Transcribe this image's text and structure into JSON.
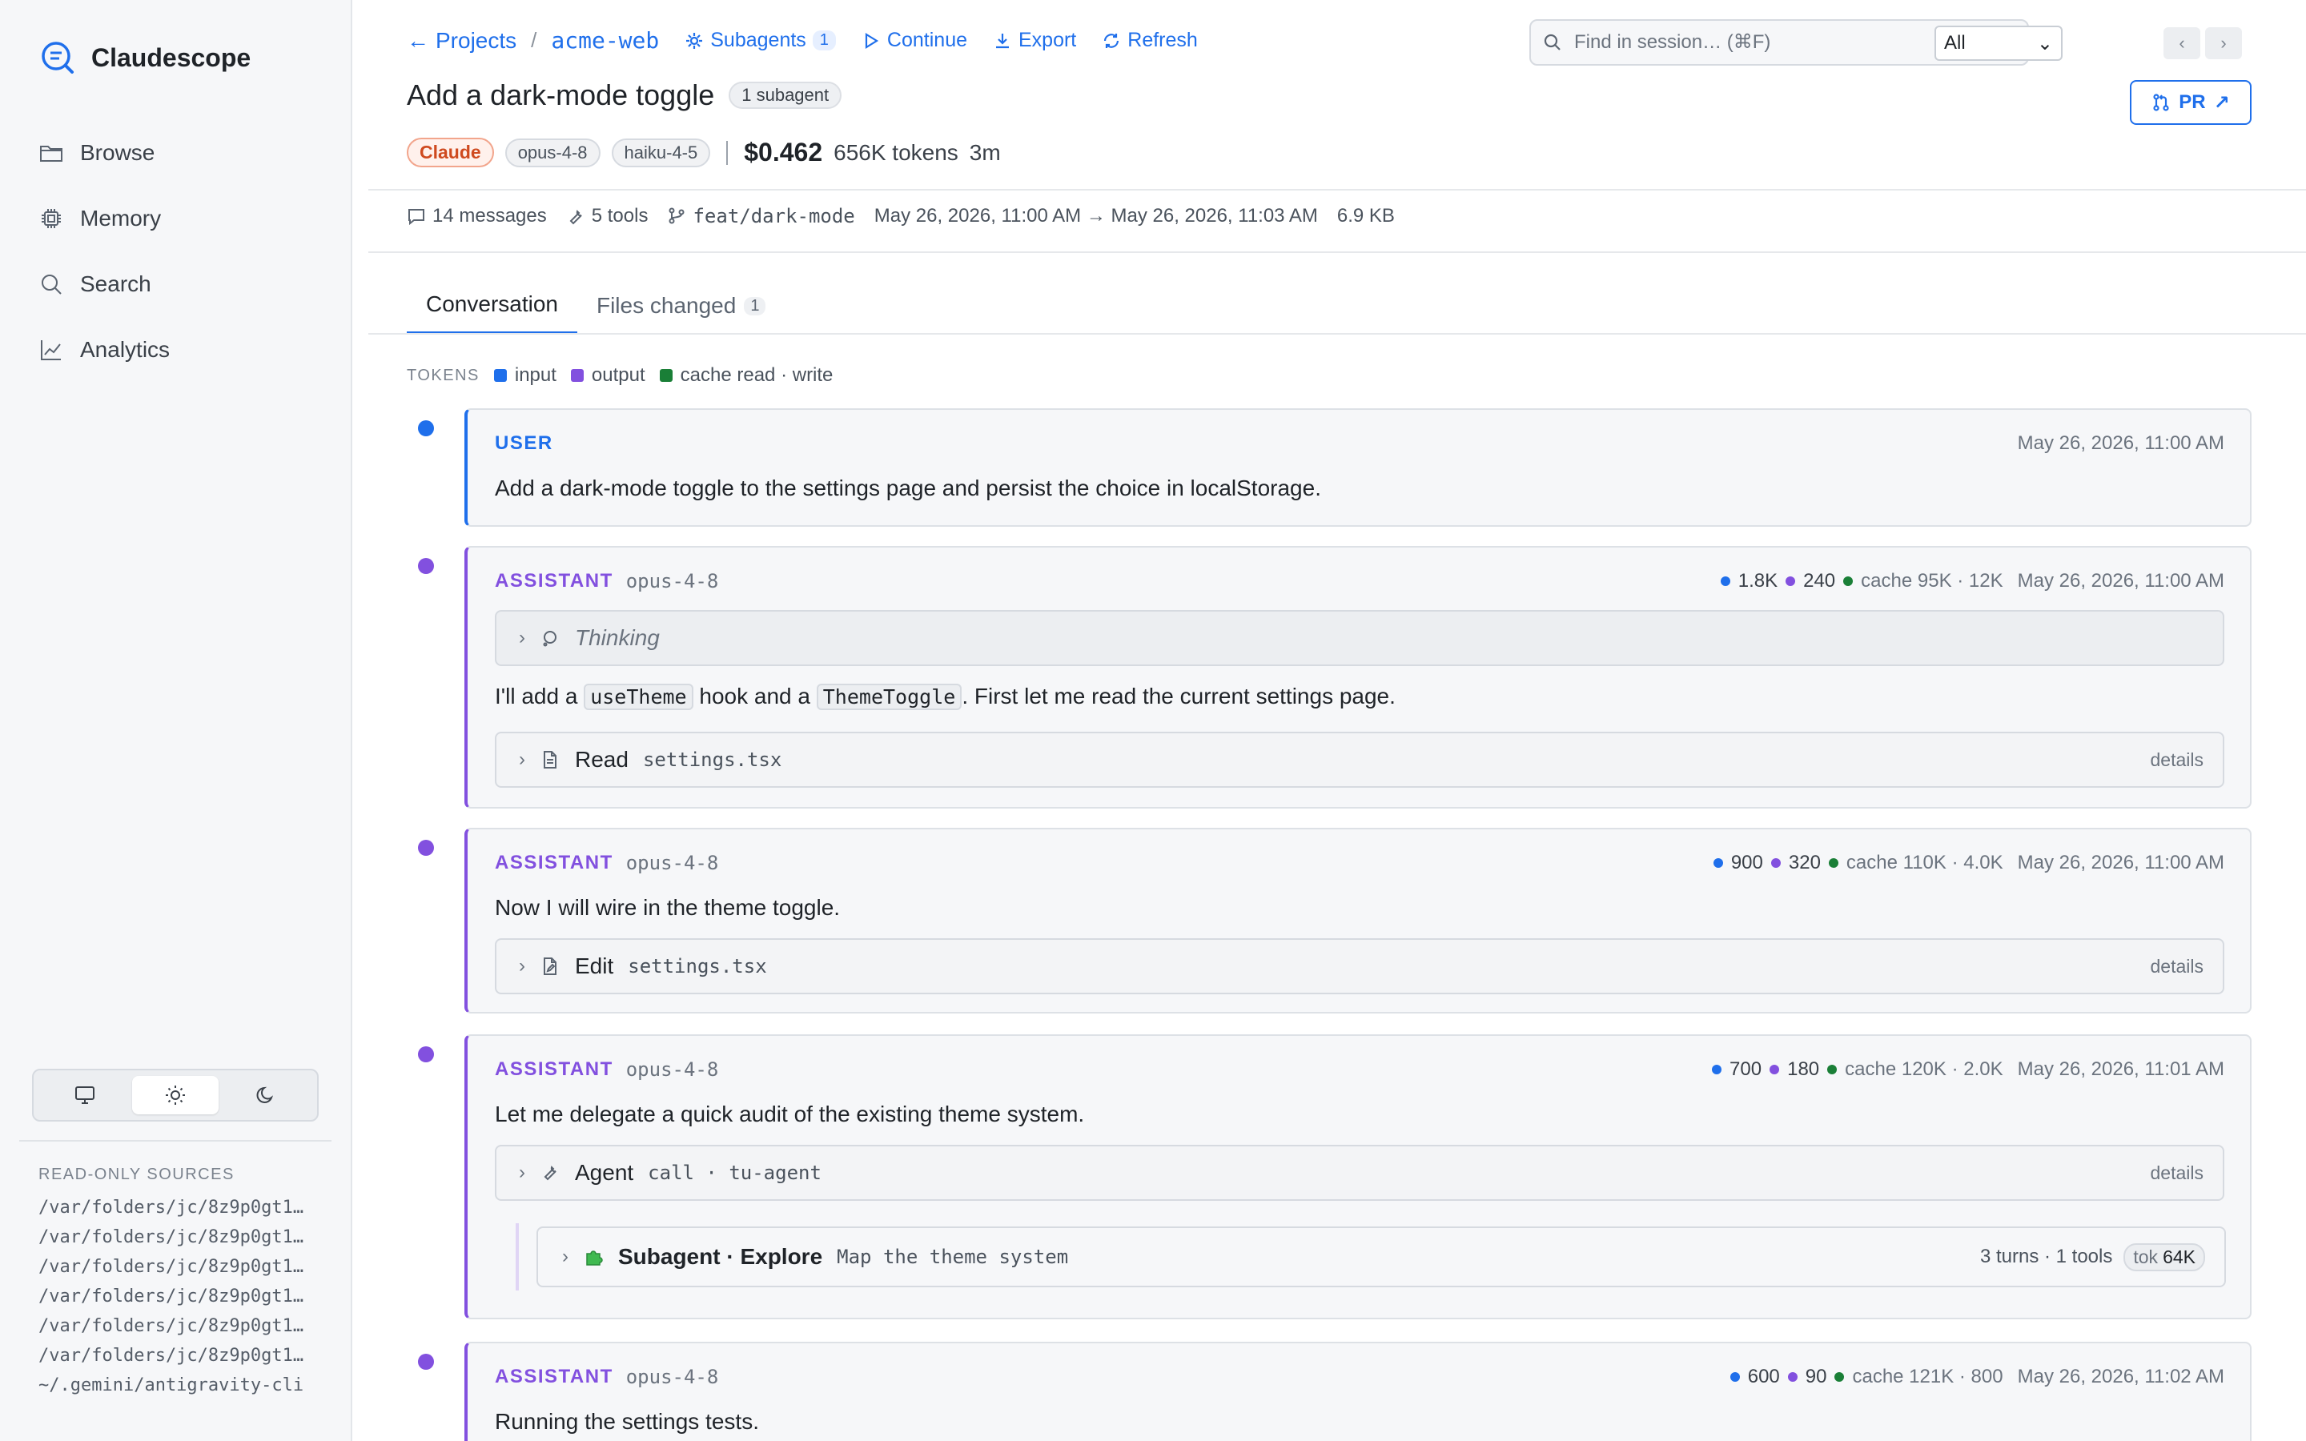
{
  "app": {
    "name": "Claudescope"
  },
  "sidebar": {
    "nav": [
      {
        "label": "Browse",
        "icon": "folder-icon"
      },
      {
        "label": "Memory",
        "icon": "chip-icon"
      },
      {
        "label": "Search",
        "icon": "search-icon"
      },
      {
        "label": "Analytics",
        "icon": "chart-icon"
      }
    ],
    "theme_options": [
      "monitor-icon",
      "sun-icon",
      "moon-icon"
    ],
    "theme_selected": "sun-icon",
    "sources_title": "READ-ONLY SOURCES",
    "sources": [
      "/var/folders/jc/8z9p0gt1…",
      "/var/folders/jc/8z9p0gt1…",
      "/var/folders/jc/8z9p0gt1…",
      "/var/folders/jc/8z9p0gt1…",
      "/var/folders/jc/8z9p0gt1…",
      "/var/folders/jc/8z9p0gt1…",
      "~/.gemini/antigravity-cli"
    ]
  },
  "header": {
    "back_label": "Projects",
    "separator": "/",
    "project": "acme-web",
    "actions": {
      "subagents": "Subagents",
      "subagents_count": "1",
      "continue": "Continue",
      "export": "Export",
      "refresh": "Refresh"
    },
    "search_placeholder": "Find in session… (⌘F)",
    "scope_selected": "All",
    "prev_arrow": "‹",
    "next_arrow": "›",
    "title": "Add a dark-mode toggle",
    "subagent_badge": "1 subagent",
    "pr_label": "PR",
    "provider": "Claude",
    "models": [
      "opus-4-8",
      "haiku-4-5"
    ],
    "cost": "$0.462",
    "tokens": "656K tokens",
    "duration": "3m"
  },
  "stats": {
    "messages": "14 messages",
    "tools": "5 tools",
    "branch": "feat/dark-mode",
    "time_range": "May 26, 2026, 11:00 AM → May 26, 2026, 11:03 AM",
    "size": "6.9 KB"
  },
  "tabs": [
    {
      "label": "Conversation",
      "active": true
    },
    {
      "label": "Files changed",
      "count": "1",
      "active": false
    }
  ],
  "legend": {
    "title": "TOKENS",
    "items": [
      {
        "label": "input",
        "color": "#1f6feb"
      },
      {
        "label": "output",
        "color": "#8250df"
      },
      {
        "label": "cache read · write",
        "color": "#1a7f37"
      }
    ]
  },
  "messages": [
    {
      "role": "USER",
      "time": "May 26, 2026, 11:00 AM",
      "text": "Add a dark-mode toggle to the settings page and persist the choice in localStorage."
    },
    {
      "role": "ASSISTANT",
      "model": "opus-4-8",
      "input": "1.8K",
      "output": "240",
      "cache": "cache 95K · 12K",
      "time": "May 26, 2026, 11:00 AM",
      "thinking": "Thinking",
      "text_a": "I'll add a ",
      "code_a": "useTheme",
      "text_b": " hook and a ",
      "code_b": "ThemeToggle",
      "text_c": ". First let me read the current settings page.",
      "tool": {
        "name": "Read",
        "arg": "settings.tsx",
        "details": "details"
      }
    },
    {
      "role": "ASSISTANT",
      "model": "opus-4-8",
      "input": "900",
      "output": "320",
      "cache": "cache 110K · 4.0K",
      "time": "May 26, 2026, 11:00 AM",
      "text": "Now I will wire in the theme toggle.",
      "tool": {
        "name": "Edit",
        "arg": "settings.tsx",
        "details": "details"
      }
    },
    {
      "role": "ASSISTANT",
      "model": "opus-4-8",
      "input": "700",
      "output": "180",
      "cache": "cache 120K · 2.0K",
      "time": "May 26, 2026, 11:01 AM",
      "text": "Let me delegate a quick audit of the existing theme system.",
      "tool": {
        "name": "Agent",
        "arg": "call · tu-agent",
        "details": "details"
      },
      "subagent": {
        "name": "Subagent · Explore",
        "desc": "Map the theme system",
        "summary": "3 turns · 1 tools",
        "tok_label": "tok",
        "tok_value": "64K"
      }
    },
    {
      "role": "ASSISTANT",
      "model": "opus-4-8",
      "input": "600",
      "output": "90",
      "cache": "cache 121K · 800",
      "time": "May 26, 2026, 11:02 AM",
      "text": "Running the settings tests."
    }
  ]
}
